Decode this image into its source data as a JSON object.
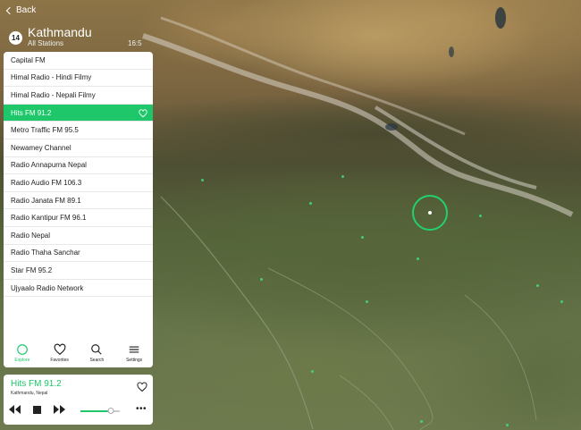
{
  "header": {
    "back_label": "Back",
    "station_count": "14",
    "city": "Kathmandu",
    "subtitle": "All Stations",
    "clock": "16:5"
  },
  "stations": [
    {
      "name": "Capital FM",
      "active": false
    },
    {
      "name": "Himal Radio - Hindi Filmy",
      "active": false
    },
    {
      "name": "Himal Radio - Nepali Filmy",
      "active": false
    },
    {
      "name": "Hits FM 91.2",
      "active": true
    },
    {
      "name": "Metro Traffic FM 95.5",
      "active": false
    },
    {
      "name": "Newamey Channel",
      "active": false
    },
    {
      "name": "Radio Annapurna Nepal",
      "active": false
    },
    {
      "name": "Radio Audio FM 106.3",
      "active": false
    },
    {
      "name": "Radio Janata FM 89.1",
      "active": false
    },
    {
      "name": "Radio Kantipur FM 96.1",
      "active": false
    },
    {
      "name": "Radio Nepal",
      "active": false
    },
    {
      "name": "Radio Thaha Sanchar",
      "active": false
    },
    {
      "name": "Star FM 95.2",
      "active": false
    },
    {
      "name": "Ujyaalo Radio Network",
      "active": false
    }
  ],
  "tabs": [
    {
      "label": "Explore",
      "icon": "explore-icon",
      "active": true
    },
    {
      "label": "Favorites",
      "icon": "heart-icon",
      "active": false
    },
    {
      "label": "Search",
      "icon": "search-icon",
      "active": false
    },
    {
      "label": "Settings",
      "icon": "settings-icon",
      "active": false
    }
  ],
  "player": {
    "station": "Hits FM 91.2",
    "location": "Kathmandu, Nepal",
    "volume": 0.78
  },
  "colors": {
    "accent": "#1dc76a"
  }
}
